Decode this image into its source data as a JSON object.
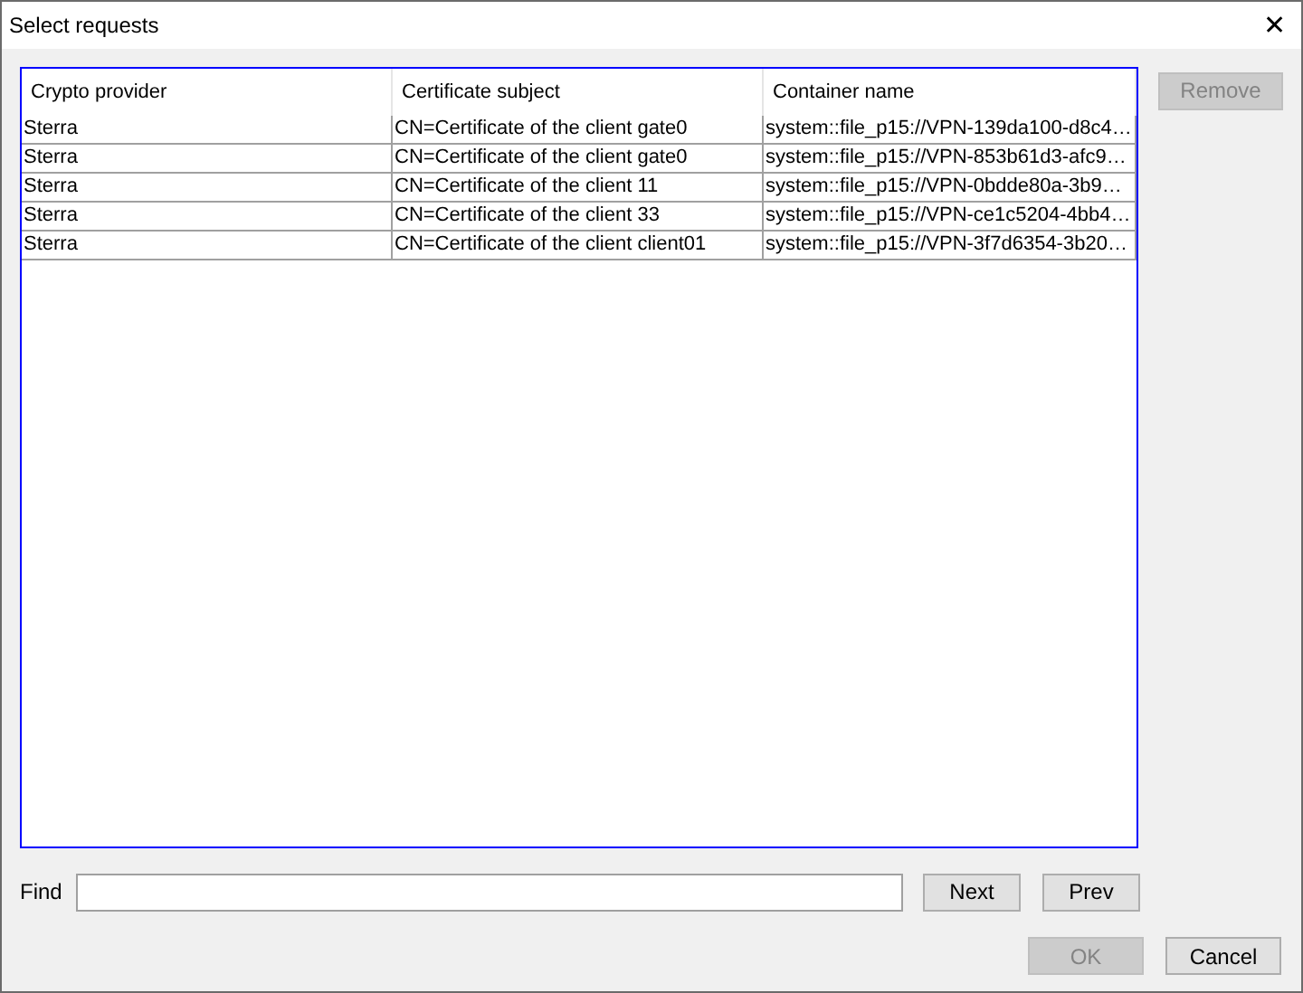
{
  "window": {
    "title": "Select requests",
    "close": "✕"
  },
  "table": {
    "columns": [
      "Crypto provider",
      "Certificate subject",
      "Container name"
    ],
    "rows": [
      [
        "Sterra",
        "CN=Certificate of the client gate0",
        "system::file_p15://VPN-139da100-d8c4…"
      ],
      [
        "Sterra",
        "CN=Certificate of the client gate0",
        "system::file_p15://VPN-853b61d3-afc9…"
      ],
      [
        "Sterra",
        "CN=Certificate of the client 11",
        "system::file_p15://VPN-0bdde80a-3b9…"
      ],
      [
        "Sterra",
        "CN=Certificate of the client 33",
        "system::file_p15://VPN-ce1c5204-4bb4…"
      ],
      [
        "Sterra",
        "CN=Certificate of the client client01",
        "system::file_p15://VPN-3f7d6354-3b20…"
      ]
    ]
  },
  "remove_button": {
    "label": "Remove",
    "disabled": true
  },
  "find": {
    "label": "Find",
    "next": {
      "label": "Next",
      "disabled": false
    },
    "prev": {
      "label": "Prev",
      "disabled": false
    }
  },
  "ok_button": {
    "label": "OK",
    "disabled": true
  },
  "cancel_button": {
    "label": "Cancel",
    "disabled": false
  }
}
